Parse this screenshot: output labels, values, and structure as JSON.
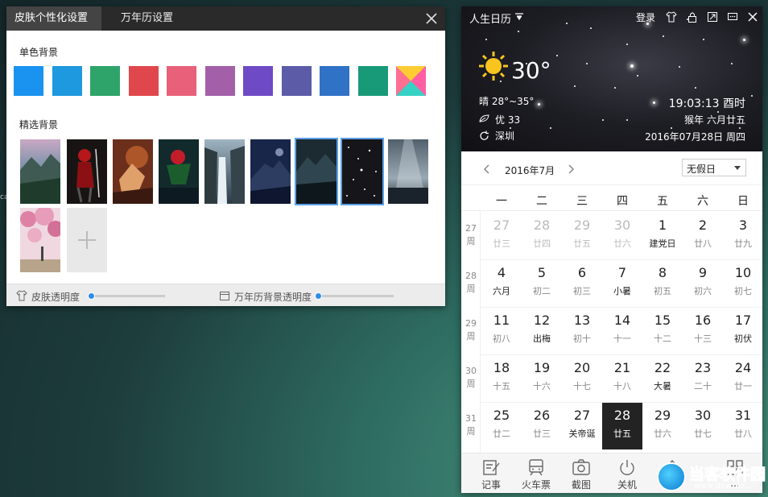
{
  "skin_dialog": {
    "tabs": [
      "皮肤个性化设置",
      "万年历设置"
    ],
    "solid_title": "单色背景",
    "solid_colors": [
      "#1a93f0",
      "#1e98de",
      "#2ea46a",
      "#e0474c",
      "#e8607a",
      "#a35fa8",
      "#6f4ac5",
      "#5b5ba7",
      "#2f72c6",
      "#189a78",
      "multicolor"
    ],
    "featured_title": "精选背景",
    "thumbnail_count": 10,
    "selected_thumbnails": [
      6,
      7
    ],
    "footer": {
      "skin_opacity_label": "皮肤透明度",
      "skin_opacity": 0,
      "cal_opacity_label": "万年历背景透明度",
      "cal_opacity": 0
    }
  },
  "calendar": {
    "title": "人生日历",
    "login": "登录",
    "weather": {
      "temperature": "30°",
      "condition": "晴  28°~35°",
      "aqi": "优  33",
      "city": "深圳"
    },
    "clock": "19:03:13 酉时",
    "lunar_year": "猴年 六月廿五",
    "date_full": "2016年07月28日 周四",
    "month_label": "2016年7月",
    "holiday_select": "无假日",
    "weekdays": [
      "一",
      "二",
      "三",
      "四",
      "五",
      "六",
      "日"
    ],
    "weeks": [
      {
        "num": "27",
        "label": "周",
        "days": [
          {
            "d": "27",
            "l": "廿三",
            "other": true
          },
          {
            "d": "28",
            "l": "廿四",
            "other": true
          },
          {
            "d": "29",
            "l": "廿五",
            "other": true
          },
          {
            "d": "30",
            "l": "廿六",
            "other": true
          },
          {
            "d": "1",
            "l": "建党日",
            "fest": true
          },
          {
            "d": "2",
            "l": "廿八"
          },
          {
            "d": "3",
            "l": "廿九"
          }
        ]
      },
      {
        "num": "28",
        "label": "周",
        "days": [
          {
            "d": "4",
            "l": "六月",
            "fest": true
          },
          {
            "d": "5",
            "l": "初二"
          },
          {
            "d": "6",
            "l": "初三"
          },
          {
            "d": "7",
            "l": "小暑",
            "fest": true
          },
          {
            "d": "8",
            "l": "初五"
          },
          {
            "d": "9",
            "l": "初六"
          },
          {
            "d": "10",
            "l": "初七"
          }
        ]
      },
      {
        "num": "29",
        "label": "周",
        "days": [
          {
            "d": "11",
            "l": "初八"
          },
          {
            "d": "12",
            "l": "出梅",
            "fest": true
          },
          {
            "d": "13",
            "l": "初十"
          },
          {
            "d": "14",
            "l": "十一"
          },
          {
            "d": "15",
            "l": "十二"
          },
          {
            "d": "16",
            "l": "十三"
          },
          {
            "d": "17",
            "l": "初伏",
            "fest": true
          }
        ]
      },
      {
        "num": "30",
        "label": "周",
        "days": [
          {
            "d": "18",
            "l": "十五"
          },
          {
            "d": "19",
            "l": "十六"
          },
          {
            "d": "20",
            "l": "十七"
          },
          {
            "d": "21",
            "l": "十八"
          },
          {
            "d": "22",
            "l": "大暑",
            "fest": true
          },
          {
            "d": "23",
            "l": "二十"
          },
          {
            "d": "24",
            "l": "廿一"
          }
        ]
      },
      {
        "num": "31",
        "label": "周",
        "days": [
          {
            "d": "25",
            "l": "廿二"
          },
          {
            "d": "26",
            "l": "廿三"
          },
          {
            "d": "27",
            "l": "关帝诞",
            "fest": true
          },
          {
            "d": "28",
            "l": "廿五",
            "today": true
          },
          {
            "d": "29",
            "l": "廿六"
          },
          {
            "d": "30",
            "l": "廿七"
          },
          {
            "d": "31",
            "l": "廿八"
          }
        ]
      }
    ],
    "toolbar": [
      "记事",
      "火车票",
      "截图",
      "关机",
      "...",
      "..."
    ]
  },
  "watermark": {
    "text": "当客软件园",
    "url": "www.downkr..."
  }
}
